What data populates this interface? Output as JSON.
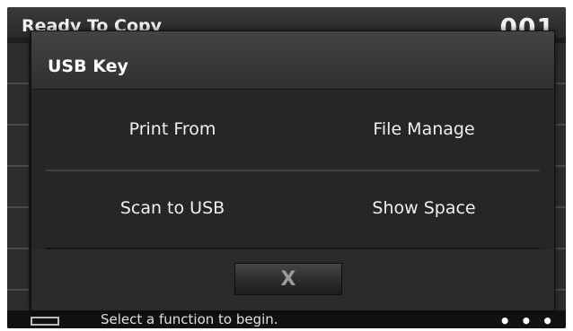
{
  "background": {
    "title": "Ready To Copy",
    "counter": "001",
    "status_text": "Select a function to begin.",
    "status_dots": "• • •"
  },
  "dialog": {
    "title": "USB Key",
    "options": [
      {
        "label": "Print From"
      },
      {
        "label": "File Manage"
      },
      {
        "label": "Scan to USB"
      },
      {
        "label": "Show Space"
      }
    ],
    "close_label": "X"
  },
  "colors": {
    "panel": "#262626",
    "header": "#3a3a3a",
    "text": "#ffffff"
  }
}
